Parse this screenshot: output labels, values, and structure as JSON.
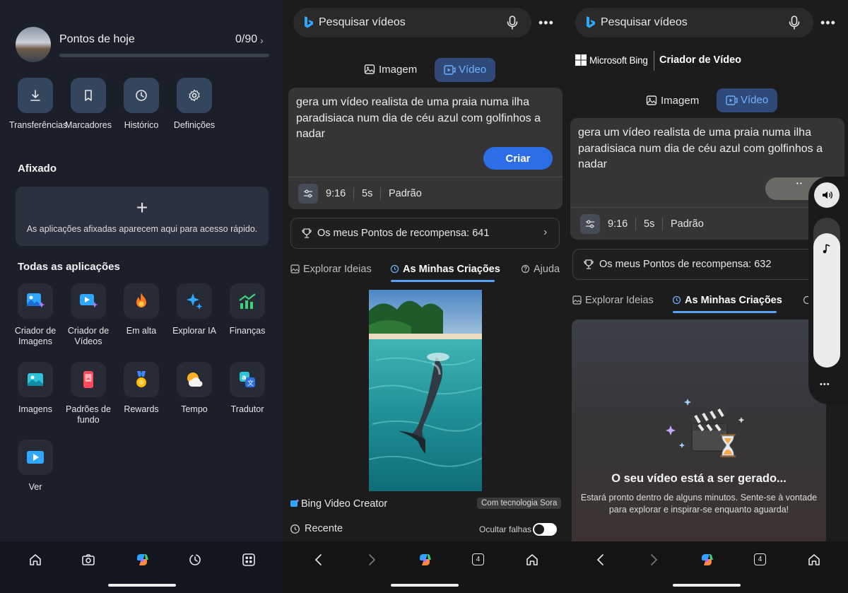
{
  "launcher": {
    "points": {
      "title": "Pontos de hoje",
      "value": "0/90"
    },
    "quick_actions": [
      {
        "label": "Transferências",
        "icon": "download-icon"
      },
      {
        "label": "Marcadores",
        "icon": "bookmark-icon"
      },
      {
        "label": "Histórico",
        "icon": "history-icon"
      },
      {
        "label": "Definições",
        "icon": "gear-icon"
      }
    ],
    "pinned": {
      "title": "Afixado",
      "empty_text": "As aplicações afixadas aparecem aqui para acesso rápido."
    },
    "all_apps": {
      "title": "Todas as aplicações",
      "apps": [
        {
          "label": "Criador de Imagens",
          "icon": "image-creator-icon"
        },
        {
          "label": "Criador de Vídeos",
          "icon": "video-creator-icon"
        },
        {
          "label": "Em alta",
          "icon": "trending-flame-icon"
        },
        {
          "label": "Explorar IA",
          "icon": "sparkle-icon"
        },
        {
          "label": "Finanças",
          "icon": "finance-chart-icon"
        },
        {
          "label": "Imagens",
          "icon": "images-icon"
        },
        {
          "label": "Padrões de fundo",
          "icon": "wallpaper-icon"
        },
        {
          "label": "Rewards",
          "icon": "medal-icon"
        },
        {
          "label": "Tempo",
          "icon": "weather-icon"
        },
        {
          "label": "Tradutor",
          "icon": "translator-icon"
        },
        {
          "label": "Ver",
          "icon": "watch-play-icon"
        }
      ]
    }
  },
  "video_creator": {
    "search_placeholder": "Pesquisar vídeos",
    "brand_microsoft": "Microsoft Bing",
    "brand_product": "Criador de Vídeo",
    "tab_image": "Imagem",
    "tab_video": "Vídeo",
    "prompt": "gera um vídeo realista de uma praia numa ilha paradisiaca num dia de céu azul com golfinhos a nadar",
    "create_button": "Criar",
    "aspect": "9:16",
    "duration": "5s",
    "quality": "Padrão",
    "rewards_before": "Os meus Pontos de recompensa: 641",
    "rewards_after": "Os meus Pontos de recompensa: 632",
    "tabs": {
      "explore": "Explorar Ideias",
      "creations": "As Minhas Criações",
      "help": "Ajuda"
    },
    "credit": "Bing Video Creator",
    "powered": "Com tecnologia Sora",
    "recent": "Recente",
    "hide_failures": "Ocultar falhas",
    "generating": {
      "title": "O seu vídeo está a ser gerado...",
      "subtitle_line1": "Estará pronto dentro de alguns minutos. Sente-se à vontade",
      "subtitle_line2": "para explorar e inspirar-se enquanto aguarda!"
    },
    "tab_count": "4"
  },
  "colors": {
    "accent": "#2d6ee6",
    "underline": "#5aa0ff"
  }
}
